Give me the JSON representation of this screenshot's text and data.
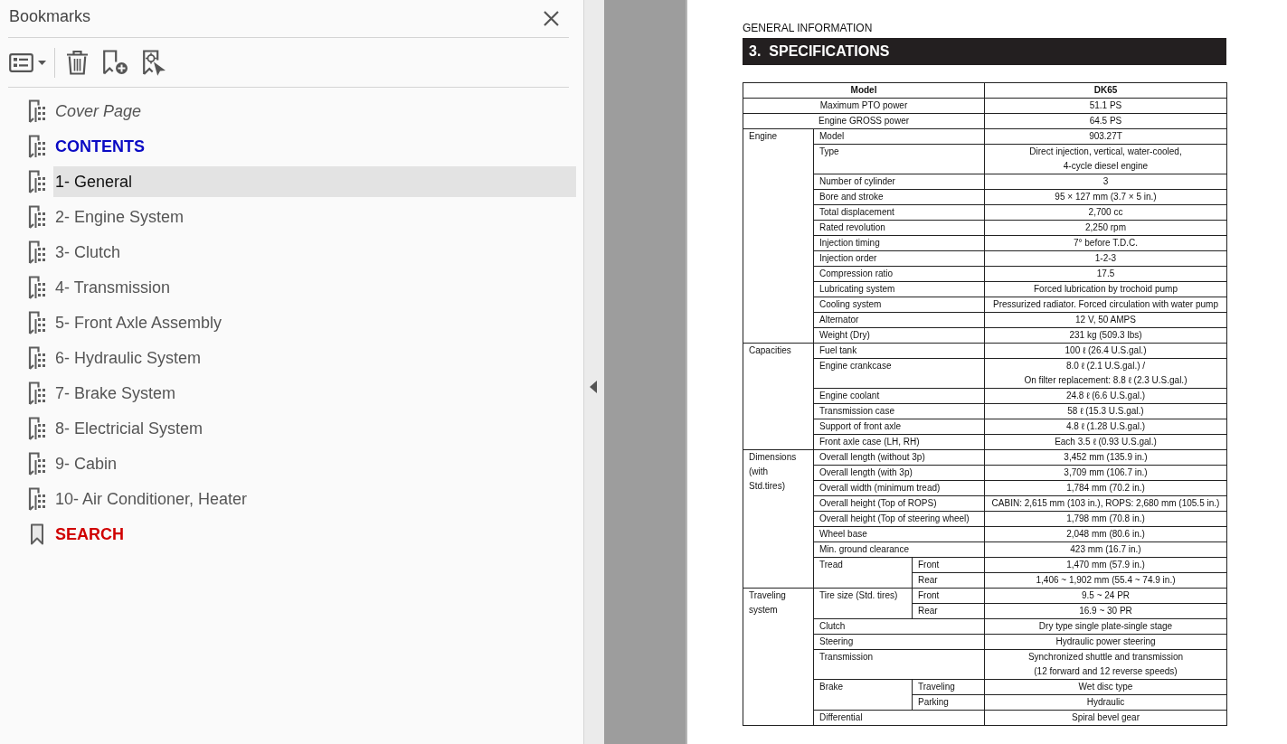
{
  "bookmarks_panel": {
    "title": "Bookmarks",
    "items": [
      {
        "label": "Cover Page",
        "kind": "chapter",
        "selected": false,
        "bold": false,
        "italic": true,
        "color": "#555555"
      },
      {
        "label": "CONTENTS",
        "kind": "chapter",
        "selected": false,
        "bold": true,
        "italic": false,
        "color": "#0a0ac4"
      },
      {
        "label": "1- General",
        "kind": "chapter",
        "selected": true,
        "bold": false,
        "italic": false,
        "color": "#111111"
      },
      {
        "label": "2- Engine System",
        "kind": "chapter",
        "selected": false,
        "bold": false,
        "italic": false,
        "color": "#555555"
      },
      {
        "label": "3- Clutch",
        "kind": "chapter",
        "selected": false,
        "bold": false,
        "italic": false,
        "color": "#555555"
      },
      {
        "label": "4- Transmission",
        "kind": "chapter",
        "selected": false,
        "bold": false,
        "italic": false,
        "color": "#555555"
      },
      {
        "label": "5- Front Axle Assembly",
        "kind": "chapter",
        "selected": false,
        "bold": false,
        "italic": false,
        "color": "#555555"
      },
      {
        "label": "6- Hydraulic System",
        "kind": "chapter",
        "selected": false,
        "bold": false,
        "italic": false,
        "color": "#555555"
      },
      {
        "label": "7- Brake System",
        "kind": "chapter",
        "selected": false,
        "bold": false,
        "italic": false,
        "color": "#555555"
      },
      {
        "label": "8- Electricial System",
        "kind": "chapter",
        "selected": false,
        "bold": false,
        "italic": false,
        "color": "#555555"
      },
      {
        "label": "9- Cabin",
        "kind": "chapter",
        "selected": false,
        "bold": false,
        "italic": false,
        "color": "#555555"
      },
      {
        "label": "10- Air Conditioner, Heater",
        "kind": "chapter",
        "selected": false,
        "bold": false,
        "italic": false,
        "color": "#555555"
      },
      {
        "label": "SEARCH",
        "kind": "bookmark",
        "selected": false,
        "bold": true,
        "italic": false,
        "color": "#d00000"
      }
    ]
  },
  "document": {
    "running_head": "GENERAL INFORMATION",
    "section_number": "3.",
    "section_title": "SPECIFICATIONS",
    "spec_table": {
      "header": {
        "label": "Model",
        "value": "DK65"
      },
      "rows": [
        {
          "item": "Maximum PTO power",
          "value": "51.1 PS"
        },
        {
          "item": "Engine GROSS power",
          "value": "64.5 PS"
        }
      ],
      "groups": [
        {
          "label": "Engine",
          "rows": [
            {
              "kind": "single",
              "item": "Model",
              "value": "903.27T"
            },
            {
              "kind": "single",
              "item": "Type",
              "value": [
                "Direct injection, vertical, water-cooled,",
                "4-cycle diesel engine"
              ]
            },
            {
              "kind": "single",
              "item": "Number of cylinder",
              "value": "3"
            },
            {
              "kind": "single",
              "item": "Bore and stroke",
              "value": "95 × 127 mm (3.7 × 5 in.)"
            },
            {
              "kind": "single",
              "item": "Total displacement",
              "value": "2,700 cc"
            },
            {
              "kind": "single",
              "item": "Rated revolution",
              "value": "2,250 rpm"
            },
            {
              "kind": "single",
              "item": "Injection timing",
              "value": "7° before T.D.C."
            },
            {
              "kind": "single",
              "item": "Injection order",
              "value": "1-2-3"
            },
            {
              "kind": "single",
              "item": "Compression ratio",
              "value": "17.5"
            },
            {
              "kind": "single",
              "item": "Lubricating system",
              "value": "Forced lubrication by trochoid pump"
            },
            {
              "kind": "single",
              "item": "Cooling system",
              "value": "Pressurized radiator. Forced circulation with water pump"
            },
            {
              "kind": "single",
              "item": "Alternator",
              "value": "12 V, 50 AMPS"
            },
            {
              "kind": "single",
              "item": "Weight (Dry)",
              "value": "231 kg (509.3 lbs)"
            }
          ]
        },
        {
          "label": "Capacities",
          "rows": [
            {
              "kind": "single",
              "item": "Fuel tank",
              "value": "100 ℓ (26.4 U.S.gal.)"
            },
            {
              "kind": "single",
              "item": "Engine crankcase",
              "value": [
                "8.0 ℓ (2.1 U.S.gal.) /",
                "On filter replacement: 8.8 ℓ (2.3 U.S.gal.)"
              ]
            },
            {
              "kind": "single",
              "item": "Engine coolant",
              "value": "24.8 ℓ (6.6 U.S.gal.)"
            },
            {
              "kind": "single",
              "item": "Transmission case",
              "value": "58 ℓ (15.3 U.S.gal.)"
            },
            {
              "kind": "single",
              "item": "Support of front axle",
              "value": "4.8 ℓ (1.28 U.S.gal.)"
            },
            {
              "kind": "single",
              "item": "Front axle case (LH, RH)",
              "value": "Each 3.5 ℓ (0.93 U.S.gal.)"
            }
          ]
        },
        {
          "label": [
            "Dimensions",
            "(with",
            "Std.tires)"
          ],
          "rows": [
            {
              "kind": "single",
              "item": "Overall length (without 3p)",
              "value": "3,452 mm (135.9 in.)"
            },
            {
              "kind": "single",
              "item": "Overall length (with 3p)",
              "value": "3,709 mm (106.7 in.)"
            },
            {
              "kind": "single",
              "item": "Overall width (minimum tread)",
              "value": "1,784 mm (70.2 in.)"
            },
            {
              "kind": "single",
              "item": "Overall height (Top of ROPS)",
              "value": "CABIN: 2,615 mm (103 in.), ROPS: 2,680 mm (105.5 in.)"
            },
            {
              "kind": "single",
              "item": "Overall height (Top of steering wheel)",
              "value": "1,798 mm (70.8 in.)"
            },
            {
              "kind": "single",
              "item": "Wheel base",
              "value": "2,048 mm (80.6 in.)"
            },
            {
              "kind": "single",
              "item": "Min. ground clearance",
              "value": "423 mm (16.7 in.)"
            },
            {
              "kind": "split",
              "item": "Tread",
              "parts": [
                {
                  "item": "Front",
                  "value": "1,470 mm (57.9 in.)"
                },
                {
                  "item": "Rear",
                  "value": "1,406 ~ 1,902 mm (55.4 ~ 74.9 in.)"
                }
              ]
            }
          ]
        },
        {
          "label": [
            "Traveling",
            "system"
          ],
          "rows": [
            {
              "kind": "split",
              "item": "Tire size (Std. tires)",
              "parts": [
                {
                  "item": "Front",
                  "value": "9.5 ~ 24 PR"
                },
                {
                  "item": "Rear",
                  "value": "16.9 ~ 30 PR"
                }
              ]
            },
            {
              "kind": "single",
              "item": "Clutch",
              "value": "Dry type single plate-single stage"
            },
            {
              "kind": "single",
              "item": "Steering",
              "value": "Hydraulic power steering"
            },
            {
              "kind": "single",
              "item": "Transmission",
              "value": [
                "Synchronized shuttle and transmission",
                "(12 forward and 12 reverse speeds)"
              ]
            },
            {
              "kind": "split",
              "item": "Brake",
              "parts": [
                {
                  "item": "Traveling",
                  "value": "Wet disc type"
                },
                {
                  "item": "Parking",
                  "value": "Hydraulic"
                }
              ]
            },
            {
              "kind": "single",
              "item": "Differential",
              "value": "Spiral bevel gear"
            }
          ]
        }
      ]
    }
  }
}
